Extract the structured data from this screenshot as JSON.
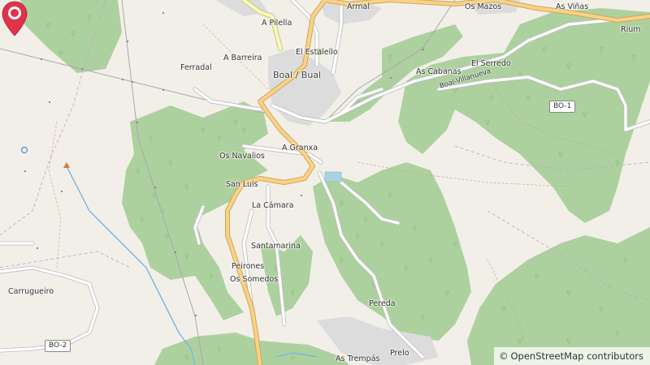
{
  "map": {
    "colors": {
      "land": "#f2efe9",
      "forest": "#add19e",
      "tree_symbol": "#8cbc80",
      "urban": "#dddddd",
      "road_major": "#f8d28a",
      "road_major_casing": "#d4a650",
      "road_secondary": "#f7fabf",
      "road_minor": "#ffffff",
      "road_minor_casing": "#bbbbbb",
      "boundary": "#c79ec7",
      "power_line": "#a8a8a8",
      "river": "#7cb5e0",
      "marker": "#e0334a"
    },
    "places": [
      {
        "key": "armal",
        "name": "Armal"
      },
      {
        "key": "os_mazos",
        "name": "Os Mazos"
      },
      {
        "key": "as_vinas",
        "name": "As Viñas"
      },
      {
        "key": "rium",
        "name": "Rium"
      },
      {
        "key": "a_pilella",
        "name": "A Pilella"
      },
      {
        "key": "el_estalello",
        "name": "El Estalello"
      },
      {
        "key": "a_barreira",
        "name": "A Barreira"
      },
      {
        "key": "ferradal",
        "name": "Ferradal"
      },
      {
        "key": "boal",
        "name": "Boal / Bual"
      },
      {
        "key": "as_cabanas",
        "name": "As Cabanas"
      },
      {
        "key": "el_serredo",
        "name": "El Serredo"
      },
      {
        "key": "a_granxa",
        "name": "A Granxa"
      },
      {
        "key": "os_navalios",
        "name": "Os Navalios"
      },
      {
        "key": "san_luis",
        "name": "San Luis"
      },
      {
        "key": "la_camara",
        "name": "La Cámara"
      },
      {
        "key": "santamarina",
        "name": "Santamarina"
      },
      {
        "key": "peirones",
        "name": "Peirones"
      },
      {
        "key": "os_somedos",
        "name": "Os Somedos"
      },
      {
        "key": "carrugueiro",
        "name": "Carrugueiro"
      },
      {
        "key": "pereda",
        "name": "Pereda"
      },
      {
        "key": "prelo",
        "name": "Prelo"
      },
      {
        "key": "as_trempas",
        "name": "As Trempás"
      }
    ],
    "roads": [
      {
        "key": "bo1",
        "ref": "BO-1"
      },
      {
        "key": "bo2",
        "ref": "BO-2"
      },
      {
        "key": "boal_villanueva",
        "name": "Boal-Villanueva"
      }
    ],
    "marker_icon": "location-pin-icon"
  },
  "attribution": {
    "copyright": "©",
    "text": "OpenStreetMap contributors"
  }
}
